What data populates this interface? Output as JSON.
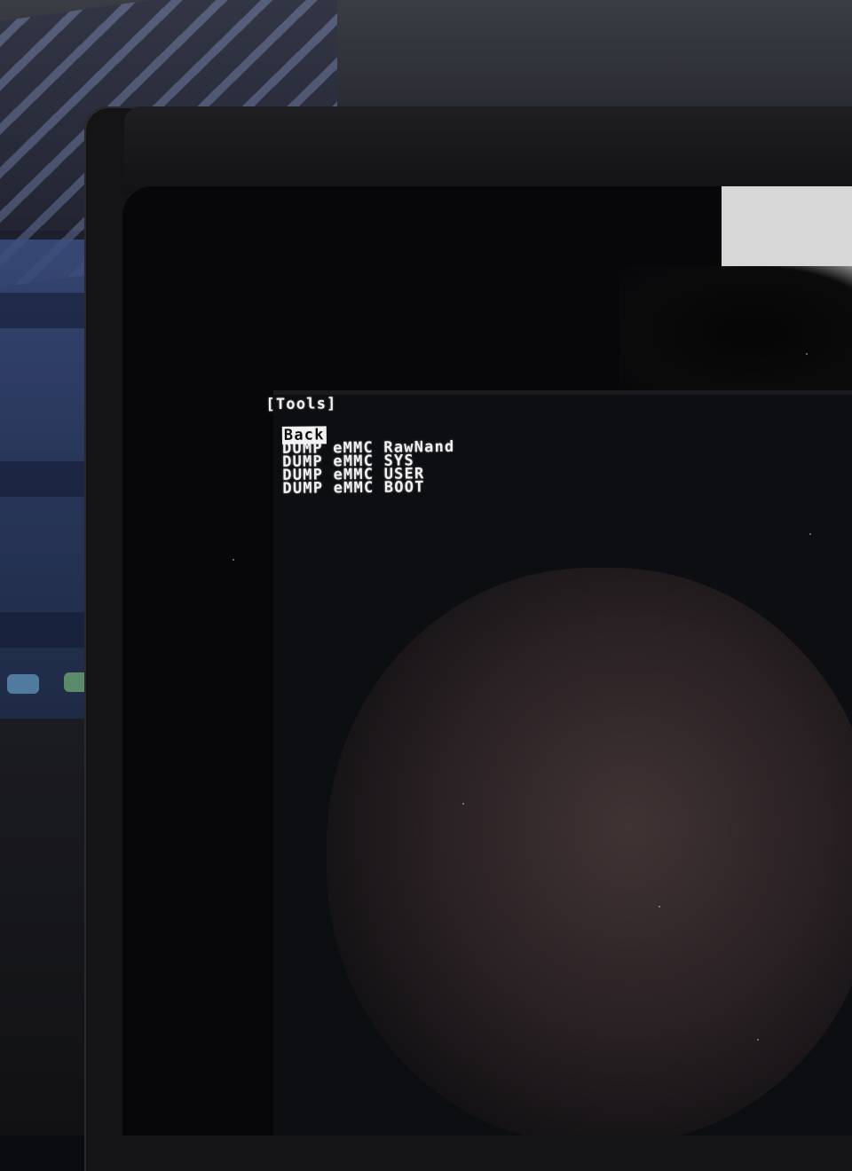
{
  "screen": {
    "title": "[Tools]",
    "menu_items": [
      {
        "label": "Back",
        "selected": true
      },
      {
        "label": "DUMP eMMC RawNand",
        "selected": false
      },
      {
        "label": "DUMP eMMC SYS",
        "selected": false
      },
      {
        "label": "DUMP eMMC USER",
        "selected": false
      },
      {
        "label": "DUMP eMMC BOOT",
        "selected": false
      }
    ]
  },
  "colors": {
    "screen_background": "#07070a",
    "text": "#f2f2f2",
    "selection_background": "#f2f2f2",
    "selection_text": "#0b0b0b"
  }
}
